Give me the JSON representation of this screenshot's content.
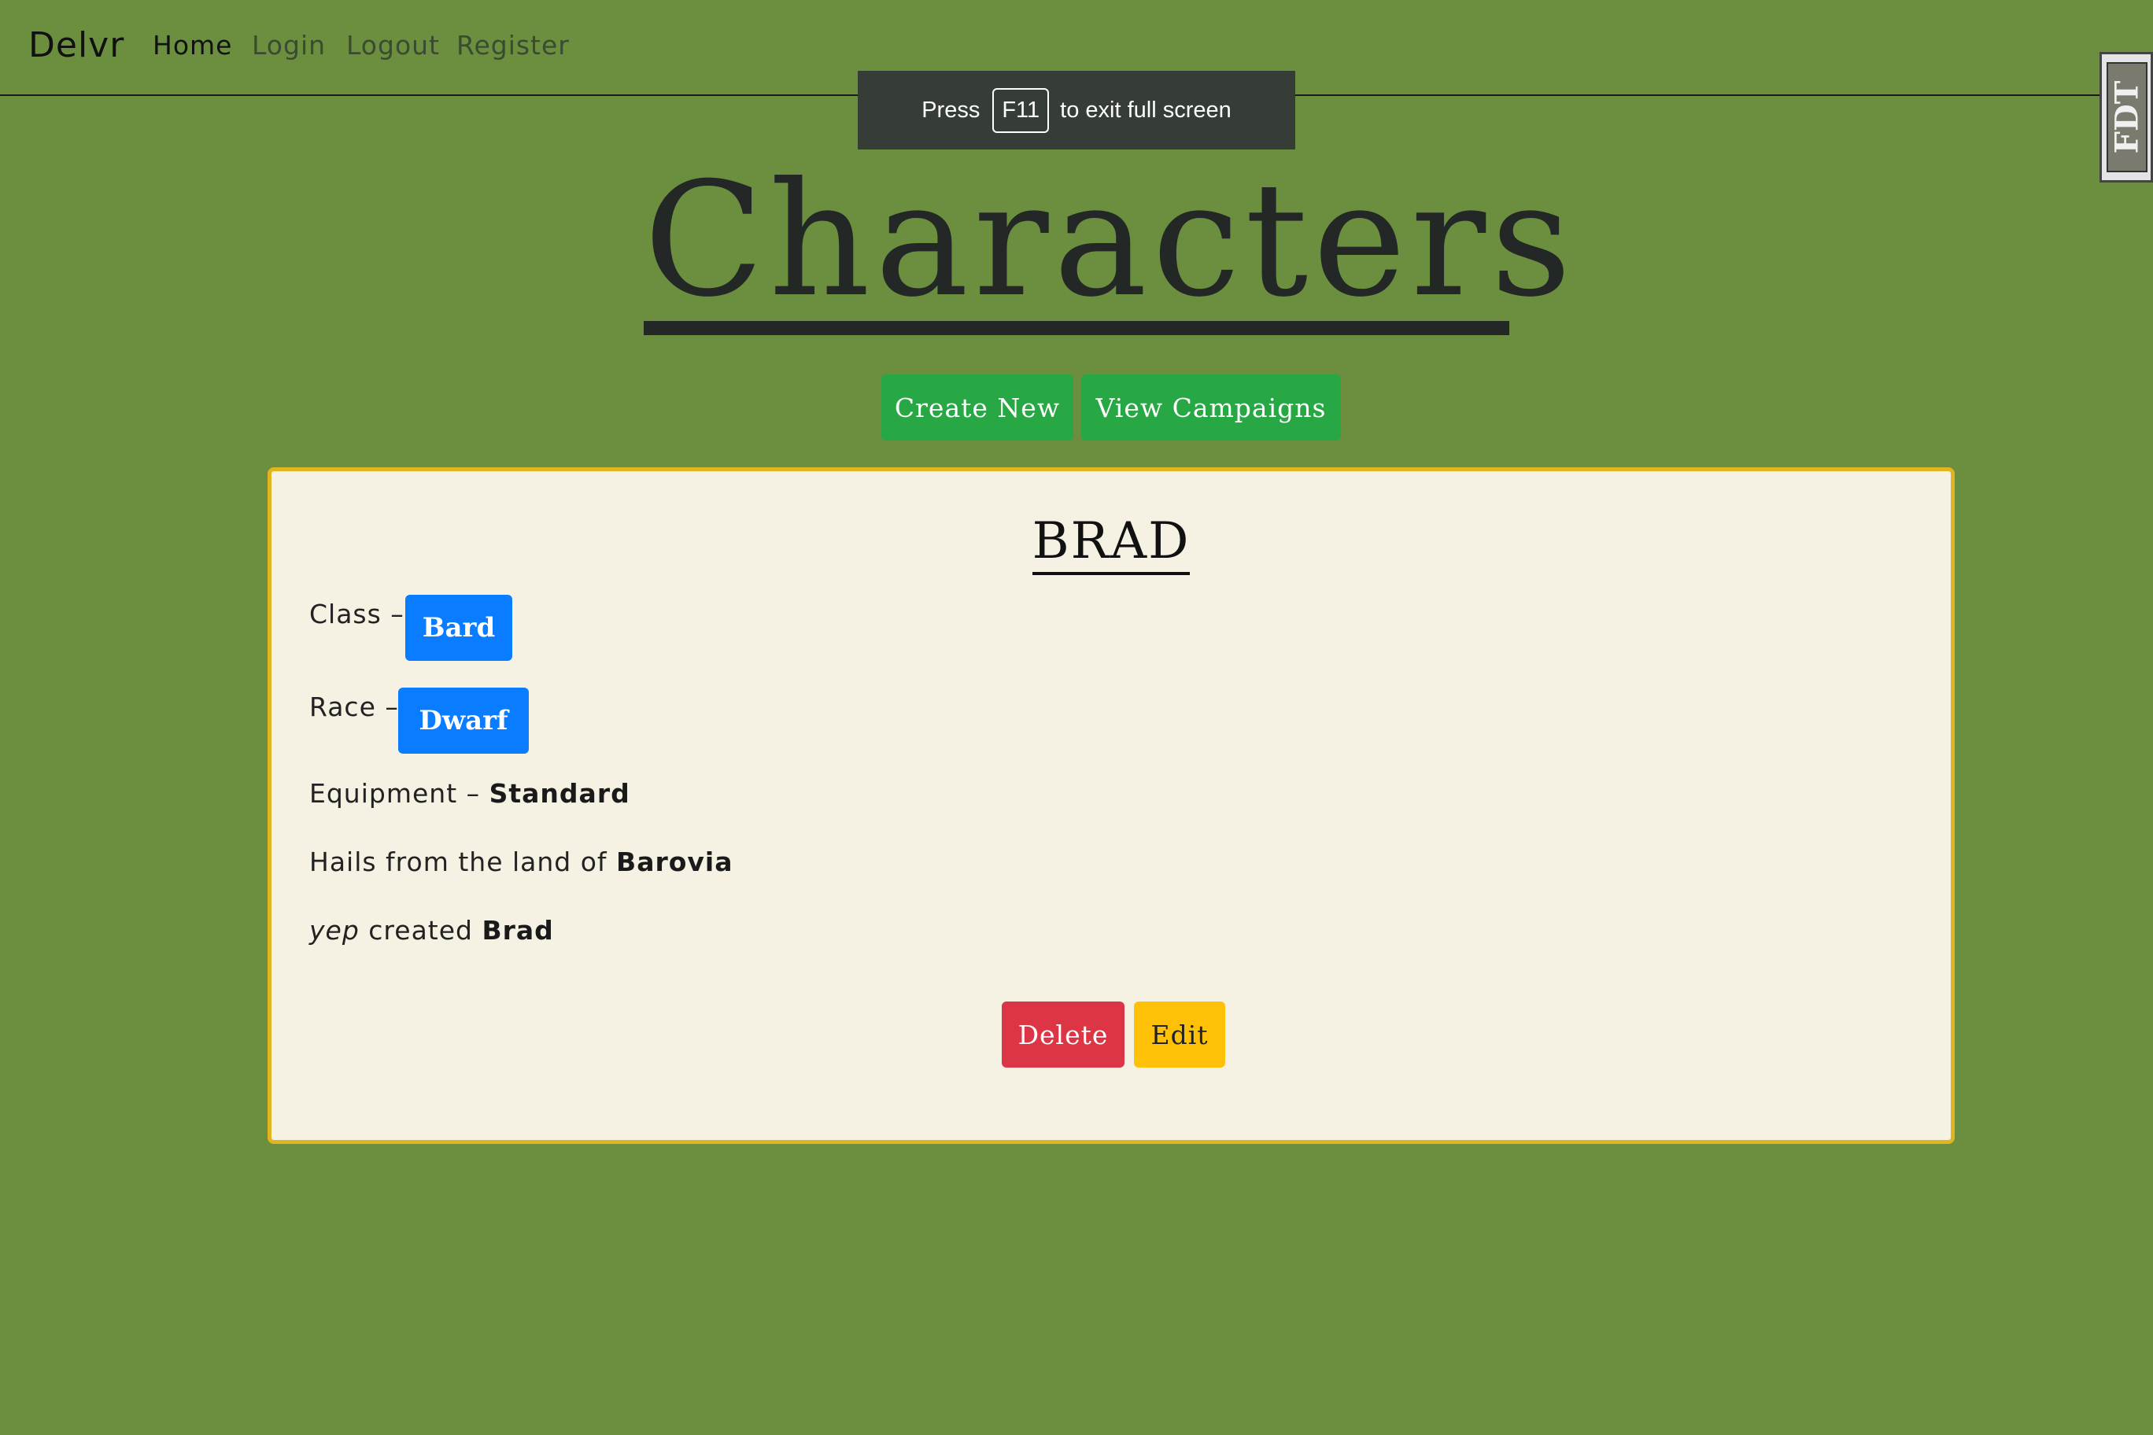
{
  "nav": {
    "brand": "Delvr",
    "links": [
      "Home",
      "Login",
      "Logout",
      "Register"
    ]
  },
  "fullscreen_notice": {
    "before": "Press",
    "key": "F11",
    "after": "to exit full screen"
  },
  "side_widget": {
    "text": "FDT"
  },
  "page": {
    "title": "Characters"
  },
  "actions": {
    "create": "Create New",
    "campaigns": "View Campaigns"
  },
  "character": {
    "name": "BRAD",
    "class_label": "Class –",
    "class_value": "Bard",
    "race_label": "Race –",
    "race_value": "Dwarf",
    "equipment_label": "Equipment –",
    "equipment_value": "Standard",
    "origin_label": "Hails from the land of",
    "origin_value": "Barovia",
    "creator_user": "yep",
    "creator_label": "created",
    "creator_value": "Brad",
    "delete_label": "Delete",
    "edit_label": "Edit"
  },
  "colors": {
    "background": "#6b8f3f",
    "card": "#f5f1e3",
    "card_border": "#e0b520",
    "success": "#28a745",
    "primary": "#0a7cff",
    "danger": "#dc3545",
    "warning": "#ffc107"
  }
}
